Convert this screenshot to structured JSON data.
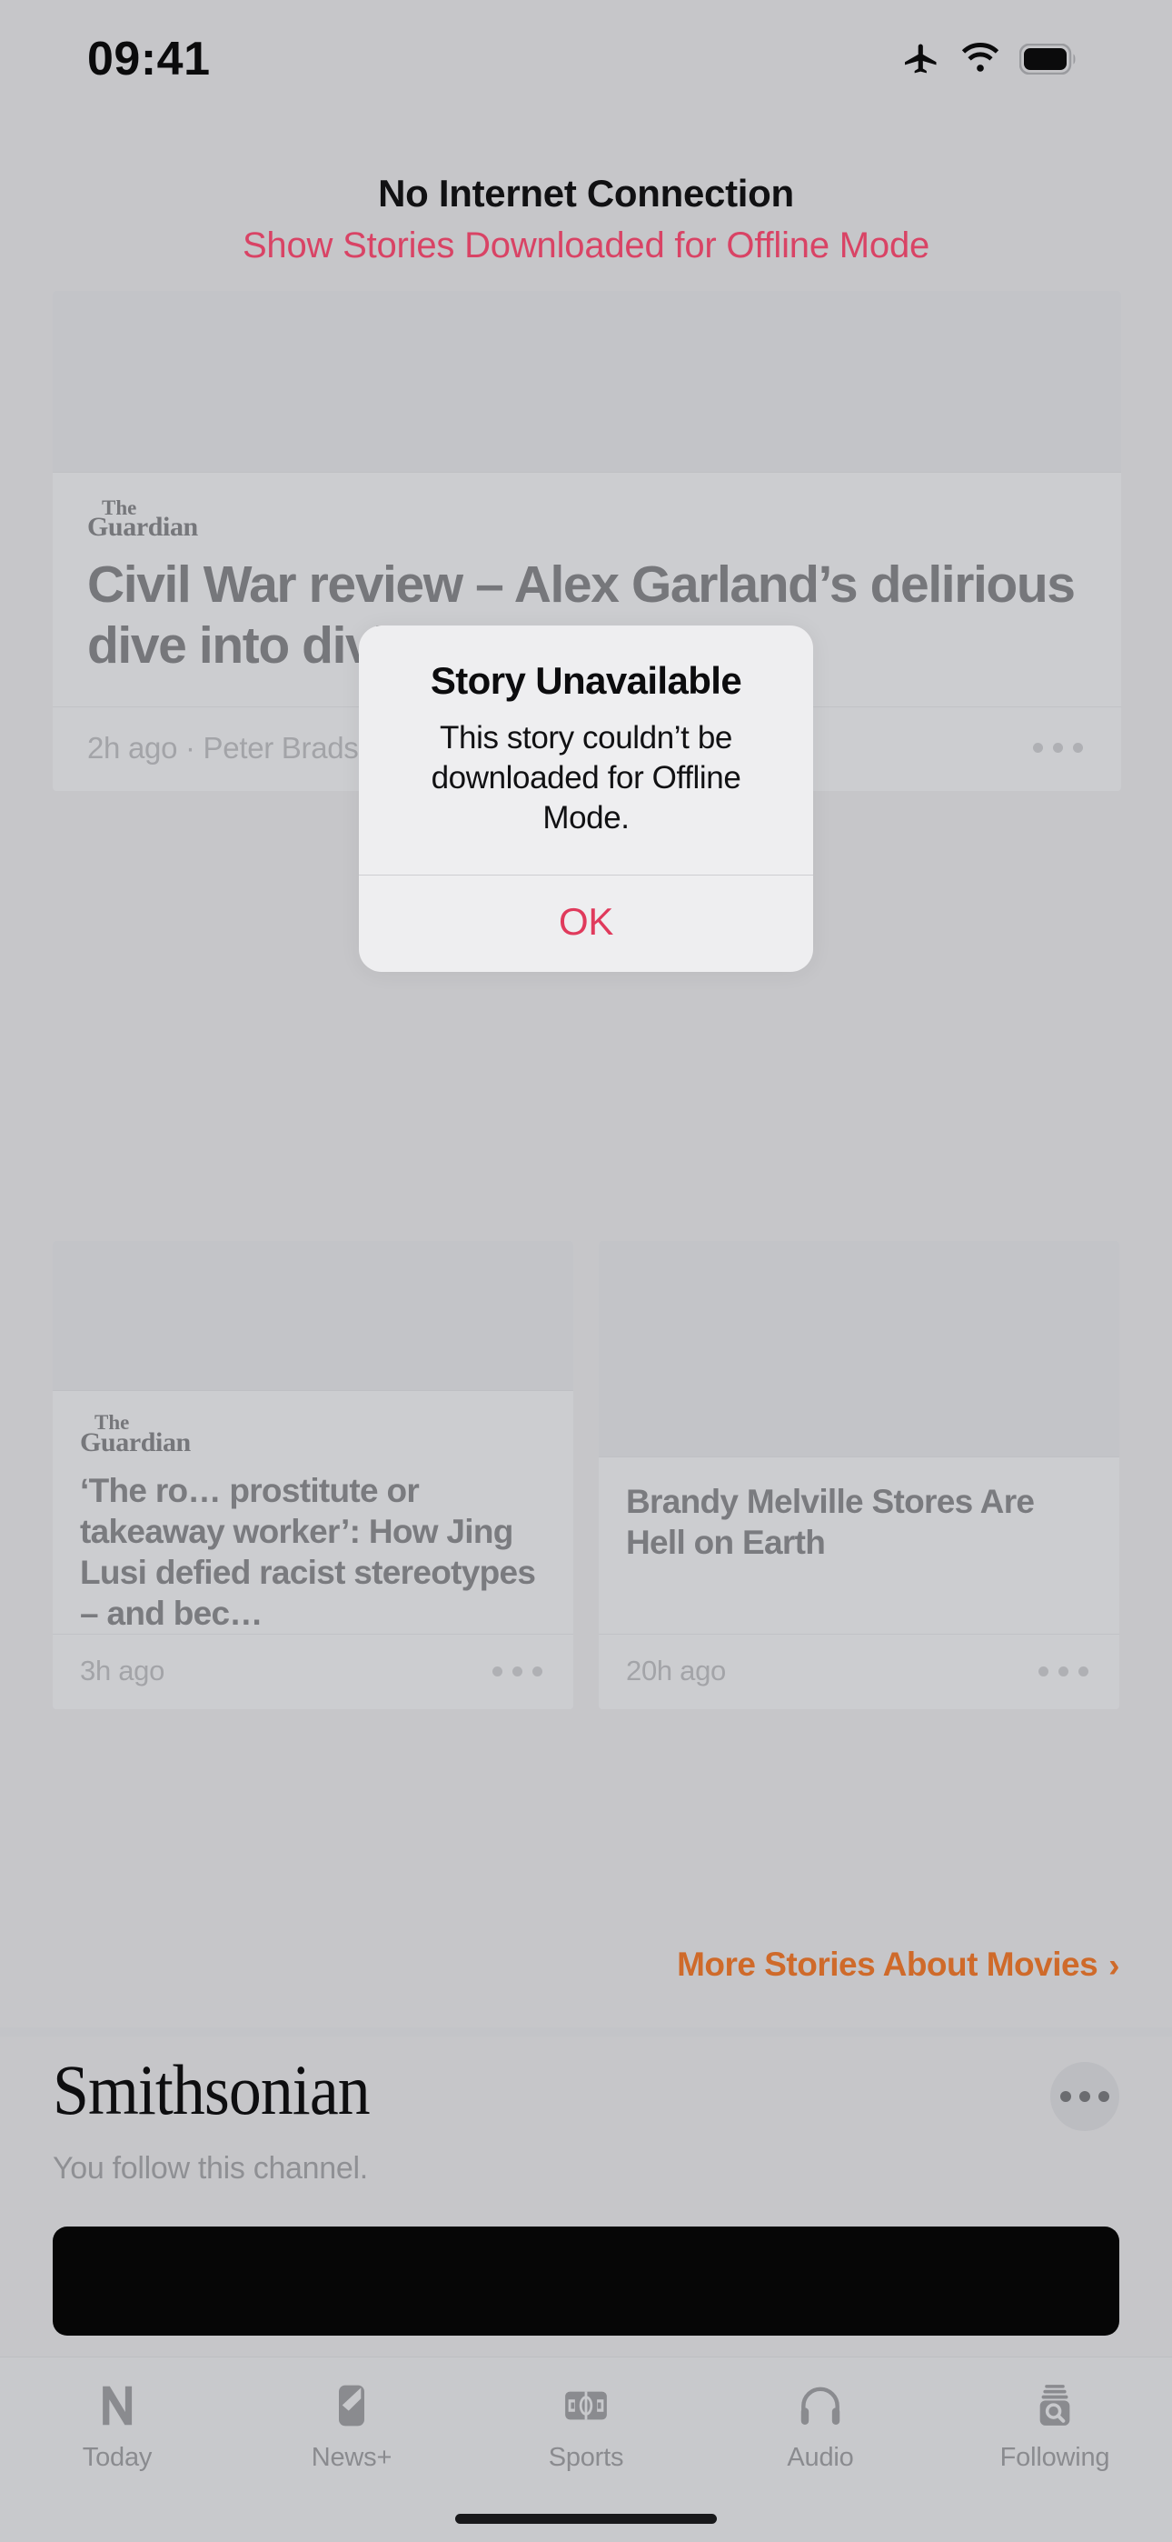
{
  "status_bar": {
    "time": "09:41",
    "icons": [
      "airplane-mode-icon",
      "wifi-icon",
      "battery-icon"
    ]
  },
  "offline_banner": {
    "title": "No Internet Connection",
    "link_label": "Show Stories Downloaded for Offline Mode",
    "link_color": "#d94365"
  },
  "feed": {
    "lead_story": {
      "publisher": "The Guardian",
      "publisher_line1": "The",
      "publisher_line2": "Guardian",
      "headline": "Civil War review – Alex Garland’s delirious dive into divided US society",
      "timestamp": "2h ago",
      "byline": "Peter Bradshaw",
      "meta": "2h ago · Peter Bradshaw",
      "overflow_label": "more-options"
    },
    "stories": [
      {
        "publisher_line1": "The",
        "publisher_line2": "Guardian",
        "headline": "‘The ro… prostitute or takeaway worker’: How Jing Lusi defied racist stereotypes – and bec…",
        "meta": "3h ago"
      },
      {
        "publisher_line1": "",
        "publisher_line2": "",
        "headline": "Brandy Melville Stores Are Hell on Earth",
        "meta": "20h ago"
      }
    ],
    "more_link": {
      "label": "More Stories About Movies",
      "chevron": "›",
      "color": "#cf6a2a"
    }
  },
  "channel_section": {
    "title": "Smithsonian",
    "subtitle": "You follow this channel.",
    "overflow_label": "channel-more-options"
  },
  "alert": {
    "title": "Story Unavailable",
    "message": "This story couldn’t be downloaded for Offline Mode.",
    "ok_label": "OK",
    "ok_color": "#e03a5c"
  },
  "tab_bar": {
    "items": [
      {
        "label": "Today",
        "icon": "apple-news-n-icon"
      },
      {
        "label": "News+",
        "icon": "news-plus-page-icon"
      },
      {
        "label": "Sports",
        "icon": "sports-field-icon"
      },
      {
        "label": "Audio",
        "icon": "headphones-icon"
      },
      {
        "label": "Following",
        "icon": "following-search-icon"
      }
    ],
    "selected": "Today"
  }
}
